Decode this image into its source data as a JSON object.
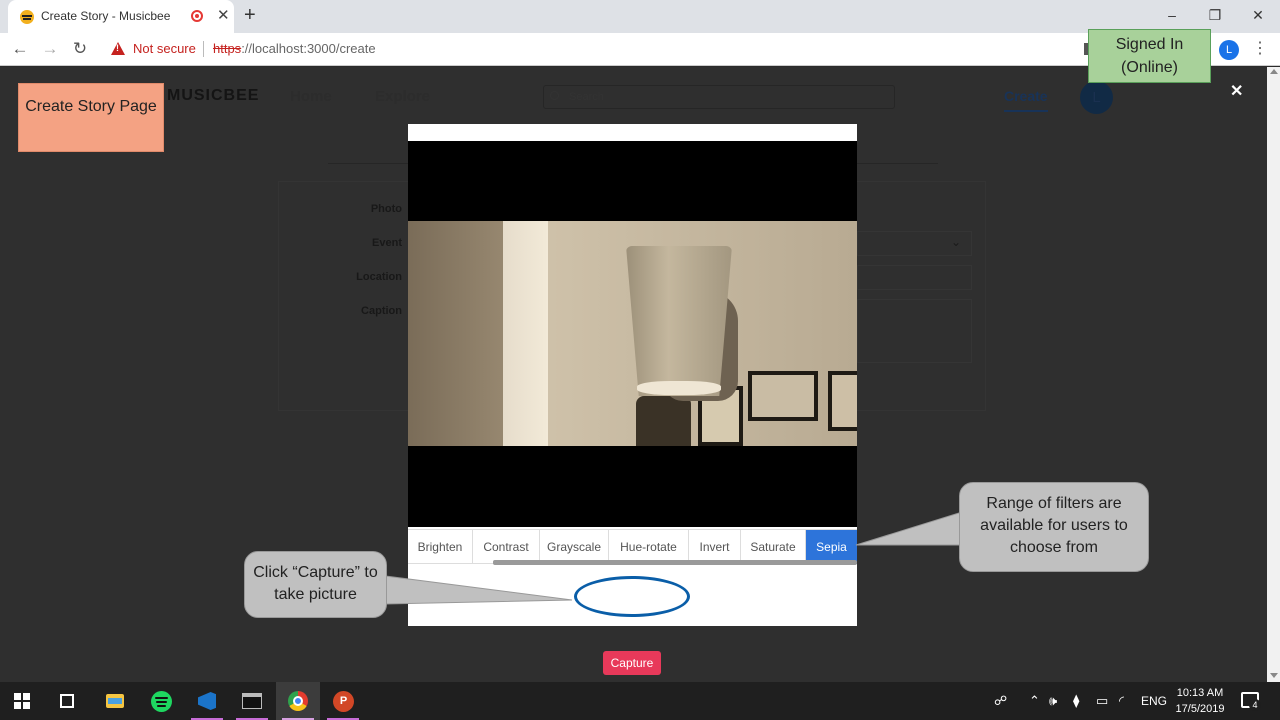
{
  "browser": {
    "tab_title": "Create Story - Musicbee",
    "new_tab_symbol": "+",
    "tab_close_symbol": "✕",
    "security_label": "Not secure",
    "url_scheme": "https",
    "url_rest": "://localhost:3000/create",
    "profile_initial": "L",
    "window_controls": {
      "minimize": "–",
      "restore": "❐",
      "close": "✕"
    }
  },
  "app_nav": {
    "brand": "MUSICBEE",
    "links": [
      "Home",
      "Explore"
    ],
    "search_placeholder": "Search",
    "create_link": "Create",
    "avatar_initial": "L",
    "close_symbol": "✕"
  },
  "form": {
    "labels": [
      "Photo",
      "Event",
      "Location",
      "Caption"
    ]
  },
  "modal": {
    "filters": [
      "Brighten",
      "Contrast",
      "Grayscale",
      "Hue-rotate",
      "Invert",
      "Saturate",
      "Sepia"
    ],
    "active_filter": "Sepia",
    "capture_label": "Capture"
  },
  "annotations": {
    "page_label": "Create Story Page",
    "signed_in_label": "Signed In (Online)",
    "filters_note": "Range of filters are available for users to choose from",
    "capture_note": "Click “Capture” to take picture"
  },
  "taskbar": {
    "language": "ENG",
    "time": "10:13 AM",
    "date": "17/5/2019",
    "notification_count": "4"
  },
  "colors": {
    "accent_blue": "#2d74da",
    "capture_pink": "#e8395a",
    "ring_blue": "#0a5ea8",
    "callout_orange": "#f4a283",
    "callout_green": "#a8d19a"
  }
}
